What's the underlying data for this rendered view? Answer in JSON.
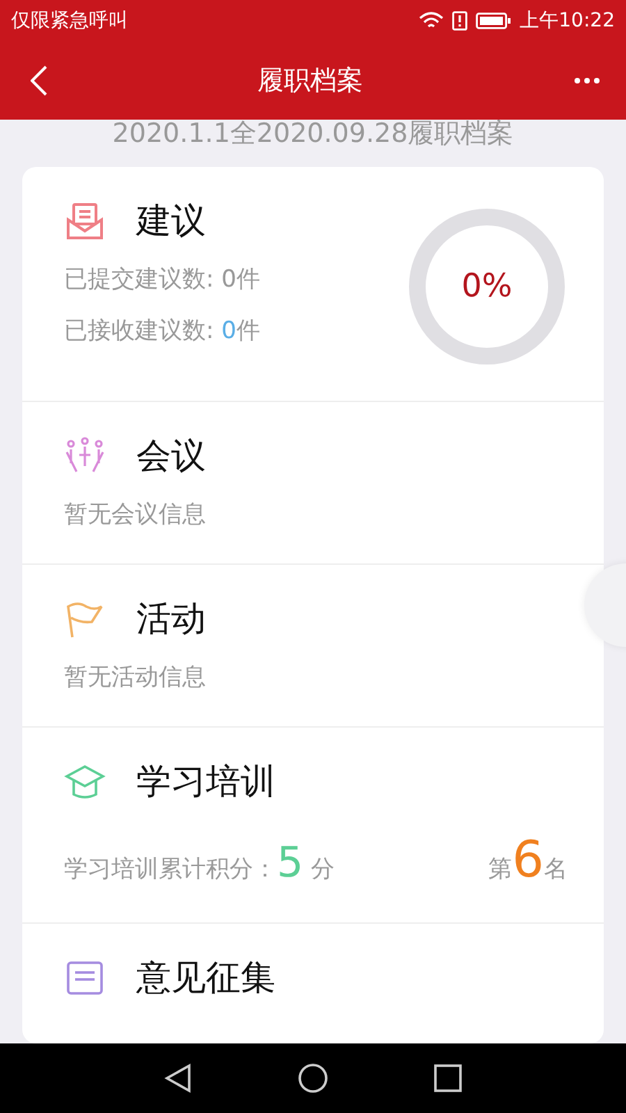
{
  "status_bar": {
    "carrier": "仅限紧急呼叫",
    "time": "上午10:22"
  },
  "header": {
    "title": "履职档案"
  },
  "period": "2020.1.1全2020.09.28履职档案",
  "sections": [
    {
      "kind": "suggestion",
      "title": "建议",
      "stats": [
        {
          "label": "已提交建议数: ",
          "value": "0",
          "unit": "件",
          "highlight": false
        },
        {
          "label": "已接收建议数: ",
          "value": "0",
          "unit": "件",
          "highlight": true
        }
      ],
      "rate": {
        "text": "0%"
      }
    },
    {
      "kind": "meeting",
      "title": "会议",
      "message": "暂无会议信息"
    },
    {
      "kind": "activity",
      "title": "活动",
      "message": "暂无活动信息"
    },
    {
      "kind": "training",
      "title": "学习培训",
      "score": {
        "label": "学习培训累计积分：",
        "value": "5",
        "unit": "分"
      },
      "rank": {
        "prefix": "第",
        "value": "6",
        "suffix": "名"
      }
    },
    {
      "kind": "opinion",
      "title": "意见征集"
    }
  ]
}
